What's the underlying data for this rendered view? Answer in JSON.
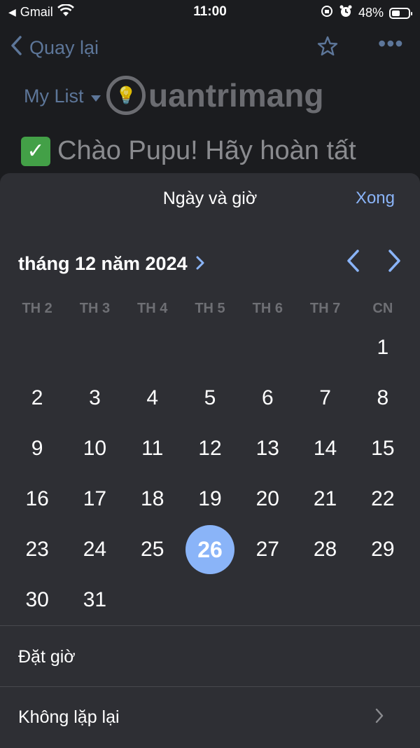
{
  "status": {
    "carrier": "Gmail",
    "time": "11:00",
    "battery": "48%",
    "battery_level": 0.48
  },
  "nav": {
    "back_label": "Quay lại"
  },
  "list": {
    "name": "My List"
  },
  "watermark": {
    "text": "uantrimang"
  },
  "task": {
    "title": "Chào Pupu! Hãy hoàn tất"
  },
  "sheet": {
    "title": "Ngày và giờ",
    "done_label": "Xong",
    "month_label": "tháng 12 năm 2024",
    "weekdays": [
      "TH 2",
      "TH 3",
      "TH 4",
      "TH 5",
      "TH 6",
      "TH 7",
      "CN"
    ],
    "days": [
      "",
      "",
      "",
      "",
      "",
      "",
      "1",
      "2",
      "3",
      "4",
      "5",
      "6",
      "7",
      "8",
      "9",
      "10",
      "11",
      "12",
      "13",
      "14",
      "15",
      "16",
      "17",
      "18",
      "19",
      "20",
      "21",
      "22",
      "23",
      "24",
      "25",
      "26",
      "27",
      "28",
      "29",
      "30",
      "31",
      "",
      "",
      "",
      "",
      ""
    ],
    "selected_day": "26",
    "set_time_label": "Đặt giờ",
    "repeat_label": "Không lặp lại"
  },
  "colors": {
    "accent": "#8ab4f8",
    "sheet_bg": "#2e2f34",
    "background": "#1b1c1f"
  }
}
